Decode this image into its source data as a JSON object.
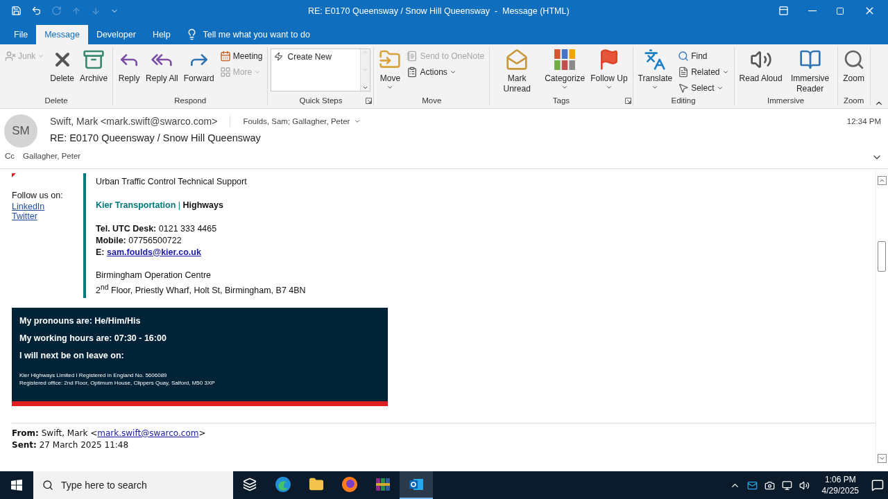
{
  "window": {
    "title": "RE: E0170 Queensway / Snow Hill Queensway  -  Message (HTML)"
  },
  "quick_access": [
    {
      "kind": "save",
      "disabled": false
    },
    {
      "kind": "undo",
      "disabled": false
    },
    {
      "kind": "redo",
      "disabled": true
    },
    {
      "kind": "up",
      "disabled": true
    },
    {
      "kind": "down",
      "disabled": true
    },
    {
      "kind": "customize",
      "disabled": false
    }
  ],
  "menu_tabs": [
    {
      "label": "File",
      "selected": false
    },
    {
      "label": "Message",
      "selected": true
    },
    {
      "label": "Developer",
      "selected": false
    },
    {
      "label": "Help",
      "selected": false
    }
  ],
  "tell_me": {
    "placeholder": "Tell me what you want to do"
  },
  "ribbon": [
    {
      "label": "Delete",
      "items": [
        {
          "kind": "small",
          "label": "Junk",
          "dropdown": true,
          "disabled": true
        },
        {
          "kind": "large",
          "label": "Delete",
          "dropdown": false,
          "disabled": false
        },
        {
          "kind": "large",
          "label": "Archive",
          "dropdown": false,
          "disabled": false
        }
      ]
    },
    {
      "label": "Respond",
      "items": [
        {
          "kind": "large",
          "label": "Reply",
          "dropdown": false,
          "disabled": false
        },
        {
          "kind": "large",
          "label": "Reply All",
          "dropdown": false,
          "disabled": false
        },
        {
          "kind": "large",
          "label": "Forward",
          "dropdown": false,
          "disabled": false
        },
        {
          "kind": "stack",
          "items": [
            {
              "label": "Meeting",
              "dropdown": false,
              "disabled": false
            },
            {
              "label": "More",
              "dropdown": true,
              "disabled": true
            }
          ]
        }
      ]
    },
    {
      "label": "Quick Steps",
      "launcher": true,
      "items": [
        {
          "kind": "gallery",
          "label": "Create New"
        }
      ]
    },
    {
      "label": "Move",
      "items": [
        {
          "kind": "large",
          "label": "Move",
          "dropdown": true,
          "disabled": false
        },
        {
          "kind": "stack",
          "items": [
            {
              "label": "Send to OneNote",
              "dropdown": false,
              "disabled": true
            },
            {
              "label": "Actions",
              "dropdown": true,
              "disabled": false
            }
          ]
        }
      ]
    },
    {
      "label": "Tags",
      "launcher": true,
      "items": [
        {
          "kind": "large",
          "label": "Mark Unread",
          "dropdown": false,
          "disabled": false
        },
        {
          "kind": "large",
          "label": "Categorize",
          "dropdown": true,
          "disabled": false
        },
        {
          "kind": "large",
          "label": "Follow Up",
          "dropdown": true,
          "disabled": false
        }
      ]
    },
    {
      "label": "Editing",
      "items": [
        {
          "kind": "large",
          "label": "Translate",
          "dropdown": true,
          "disabled": false
        },
        {
          "kind": "stack",
          "items": [
            {
              "label": "Find",
              "dropdown": false,
              "disabled": false
            },
            {
              "label": "Related",
              "dropdown": true,
              "disabled": false
            },
            {
              "label": "Select",
              "dropdown": true,
              "disabled": false
            }
          ]
        }
      ]
    },
    {
      "label": "Immersive",
      "items": [
        {
          "kind": "large",
          "label": "Read Aloud",
          "dropdown": false,
          "disabled": false
        },
        {
          "kind": "large",
          "label": "Immersive Reader",
          "dropdown": false,
          "disabled": false
        }
      ]
    },
    {
      "label": "Zoom",
      "items": [
        {
          "kind": "large",
          "label": "Zoom",
          "dropdown": false,
          "disabled": false
        }
      ]
    }
  ],
  "header": {
    "avatar": "SM",
    "from": "Swift, Mark <mark.swift@swarco.com>",
    "to": "Foulds, Sam; Gallagher, Peter",
    "time": "12:34 PM",
    "subject": "RE: E0170 Queensway / Snow Hill Queensway",
    "cc_label": "Cc",
    "cc": "Gallagher, Peter"
  },
  "body": {
    "follow": {
      "label": "Follow us on:",
      "links": [
        "LinkedIn",
        "Twitter"
      ]
    },
    "signature": {
      "role": "Urban Traffic Control Technical Support",
      "company": "Kier Transportation",
      "separator": "|",
      "division": "Highways",
      "contacts": [
        {
          "label": "Tel. UTC Desk:",
          "value": "0121 333 4465",
          "kind": "text"
        },
        {
          "label": "Mobile:",
          "value": "07756500722",
          "kind": "text"
        },
        {
          "label": "E:",
          "value": "sam.foulds@kier.co.uk",
          "kind": "link"
        }
      ],
      "office": "Birmingham Operation Centre",
      "address": "2$^{nd}$ Floor, Priestly Wharf, Holt St, Birmingham,  B7 4BN"
    },
    "banner": {
      "lines": [
        "My pronouns are:  He/Him/His",
        "My working hours are: 07:30  - 16:00",
        "I will next be on leave on:"
      ],
      "legal": [
        "Kier Highways Limited I Registered in England No. 5606089",
        "Registered office: 2nd Floor, Optimum House, Clippers Quay, Salford, M50 3XP"
      ]
    },
    "from": {
      "label": "From:",
      "prefix": "Swift, Mark <",
      "email": "mark.swift@swarco.com",
      "suffix": ">"
    },
    "sent": {
      "label": "Sent:",
      "value": "27 March 2025 11:48"
    }
  },
  "taskbar": {
    "search": {
      "placeholder": "Type here to search"
    },
    "apps": [
      {
        "kind": "taskview",
        "selected": false
      },
      {
        "kind": "edge",
        "selected": false
      },
      {
        "kind": "explorer",
        "selected": false
      },
      {
        "kind": "firefox",
        "selected": false
      },
      {
        "kind": "winrar",
        "selected": false
      },
      {
        "kind": "outlook",
        "selected": true
      }
    ],
    "time": "1:06 PM",
    "date": "4/29/2025"
  }
}
